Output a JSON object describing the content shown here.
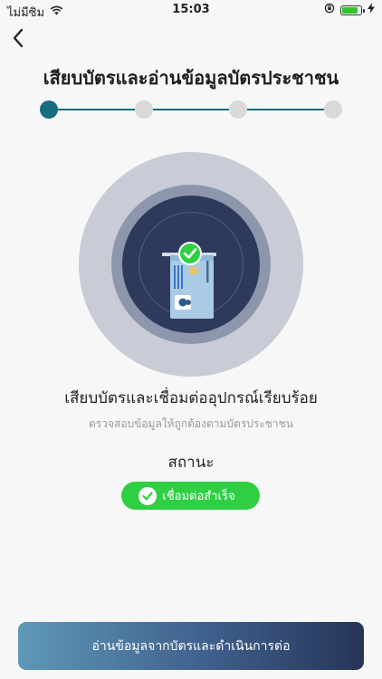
{
  "status_bar": {
    "carrier": "ไม่มีซิม",
    "time": "15:03",
    "battery_level": 0.85
  },
  "header": {
    "title": "เสียบบัตรและอ่านข้อมูลบัตรประชาชน"
  },
  "stepper": {
    "total_steps": 4,
    "current_step": 1,
    "active_color": "#176c80",
    "inactive_color": "#d9d9d9"
  },
  "main": {
    "heading": "เสียบบัตรและเชื่อมต่ออุปกรณ์เรียบร้อย",
    "subheading": "ตรวจสอบข้อมูลให้ถูกต้องตามบัตรประชาชน",
    "status_label": "สถานะ",
    "status_badge": "เชื่อมต่อสำเร็จ"
  },
  "footer": {
    "button_label": "อ่านข้อมูลจากบัตรและดำเนินการต่อ"
  },
  "colors": {
    "success": "#2fcf44",
    "primary": "#176c80"
  },
  "icons": {
    "back": "chevron-left-icon",
    "wifi": "wifi-icon",
    "check": "check-icon",
    "card": "id-card-icon"
  }
}
